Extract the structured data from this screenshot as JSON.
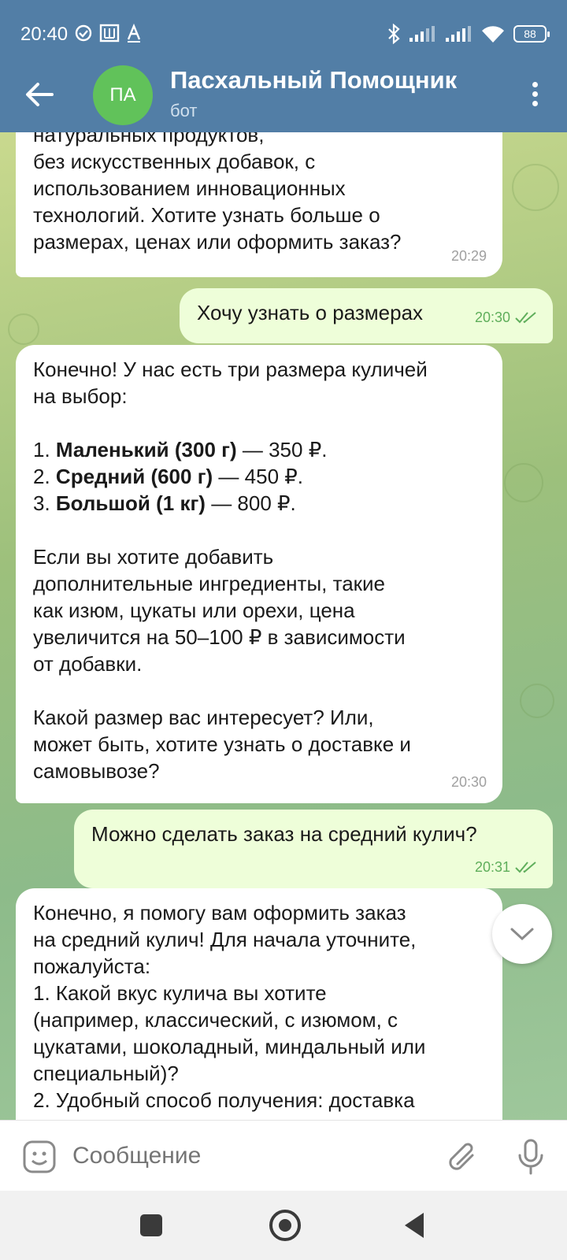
{
  "status_bar": {
    "time": "20:40",
    "battery": "88"
  },
  "header": {
    "avatar_initials": "ПА",
    "title": "Пасхальный Помощник",
    "subtitle": "бот",
    "avatar_color": "#61c25a",
    "bar_color": "#527ea6"
  },
  "messages": [
    {
      "direction": "in",
      "lines_partial_top": "натуральных продуктов,",
      "text": "без искусственных добавок, с\nиспользованием инновационных\nтехнологий. Хотите узнать больше о\nразмерах, ценах или оформить заказ?",
      "time": "20:29"
    },
    {
      "direction": "out",
      "text": "Хочу узнать о размерах",
      "time": "20:30"
    },
    {
      "direction": "in",
      "intro": "Конечно! У нас есть три размера куличей\nна выбор:",
      "sizes": [
        {
          "num": "1.",
          "name": "Маленький (300 г)",
          "price": "— 350 ₽."
        },
        {
          "num": "2.",
          "name": "Средний (600 г)",
          "price": "— 450 ₽."
        },
        {
          "num": "3.",
          "name": "Большой (1 кг)",
          "price": "— 800 ₽."
        }
      ],
      "addons": "Если вы хотите добавить\nдополнительные ингредиенты, такие\nкак изюм, цукаты или орехи, цена\nувеличится на 50–100 ₽ в зависимости\nот добавки.",
      "question": "Какой размер вас интересует? Или,\nможет быть, хотите узнать о доставке и\nсамовывозе?",
      "time": "20:30"
    },
    {
      "direction": "out",
      "text": "Можно сделать заказ на средний кулич?",
      "time": "20:31"
    },
    {
      "direction": "in",
      "text": "Конечно, я помогу вам оформить заказ\nна средний кулич! Для начала уточните,\nпожалуйста:\n1. Какой вкус кулича вы хотите\n(например, классический, с изюмом, с\nцукатами, шоколадный, миндальный или\nспециальный)?\n2. Удобный способ получения: доставка"
    }
  ],
  "input": {
    "placeholder": "Сообщение"
  }
}
